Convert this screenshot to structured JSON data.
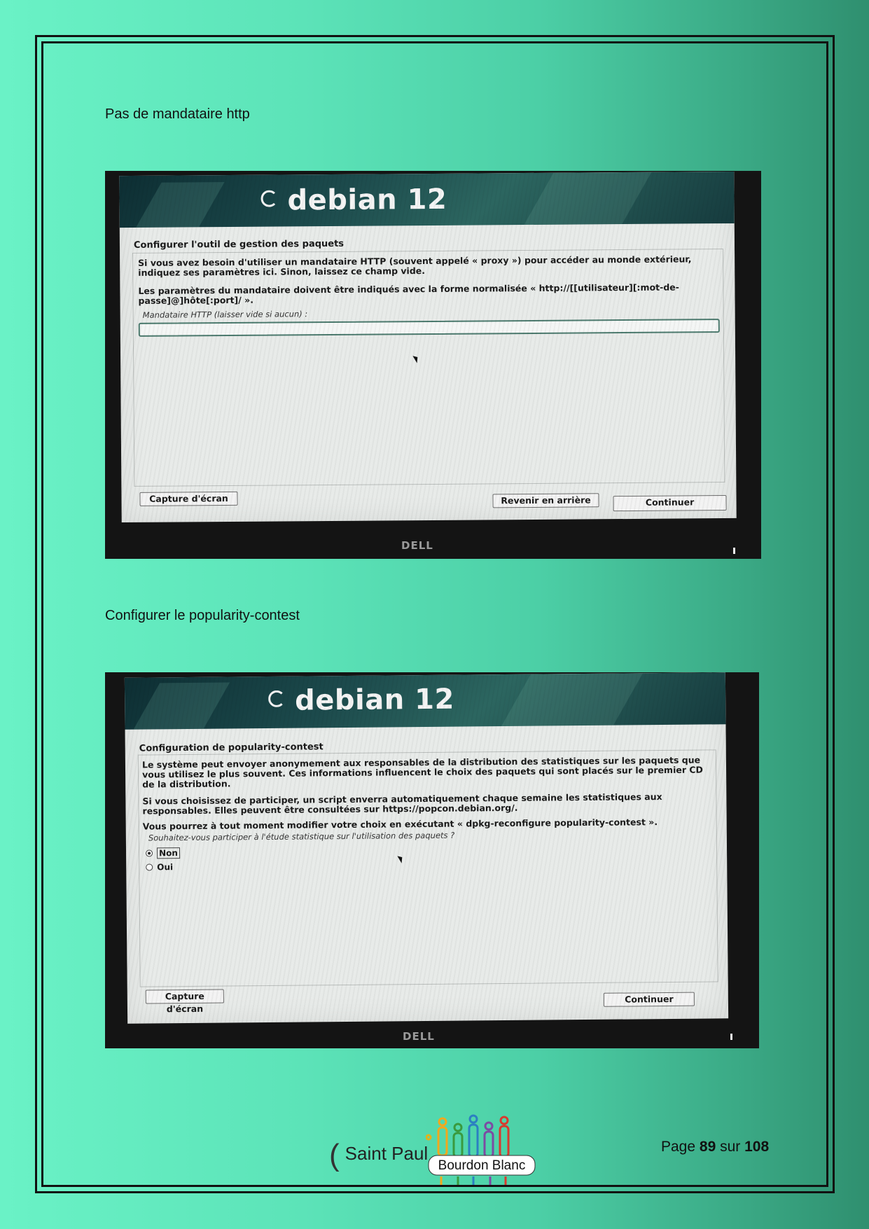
{
  "sections": [
    {
      "heading": "Pas de mandataire http",
      "screen": {
        "brand": "debian 12",
        "dialog_title": "Configurer l'outil de gestion des paquets",
        "paragraph1": "Si vous avez besoin d'utiliser un mandataire HTTP (souvent appelé « proxy ») pour accéder au monde extérieur, indiquez ses paramètres ici. Sinon, laissez ce champ vide.",
        "paragraph2": "Les paramètres du mandataire doivent être indiqués avec la forme normalisée « http://[[utilisateur][:mot-de-passe]@]hôte[:port]/ ».",
        "prompt": "Mandataire HTTP (laisser vide si aucun) :",
        "input_value": "",
        "screenshot_button": "Capture d'écran",
        "back_button": "Revenir en arrière",
        "continue_button": "Continuer",
        "monitor_logo": "DELL"
      }
    },
    {
      "heading": "Configurer le popularity-contest",
      "screen": {
        "brand": "debian 12",
        "dialog_title": "Configuration de popularity-contest",
        "paragraph1": "Le système peut envoyer anonymement aux responsables de la distribution des statistiques sur les paquets que vous utilisez le plus souvent. Ces informations influencent le choix des paquets qui sont placés sur le premier CD de la distribution.",
        "paragraph2": "Si vous choisissez de participer, un script enverra automatiquement chaque semaine les statistiques aux responsables. Elles peuvent être consultées sur https://popcon.debian.org/.",
        "paragraph3": "Vous pourrez à tout moment modifier votre choix en exécutant « dpkg-reconfigure popularity-contest ».",
        "prompt": "Souhaitez-vous participer à l'étude statistique sur l'utilisation des paquets ?",
        "options": [
          {
            "label": "Non",
            "selected": true
          },
          {
            "label": "Oui",
            "selected": false
          }
        ],
        "screenshot_button": "Capture d'écran",
        "continue_button": "Continuer",
        "monitor_logo": "DELL"
      }
    }
  ],
  "footer": {
    "school_name": "Saint Paul",
    "school_logo_text": "Bourdon Blanc",
    "page_prefix": "Page",
    "page_current": "89",
    "page_separator": "sur",
    "page_total": "108"
  }
}
